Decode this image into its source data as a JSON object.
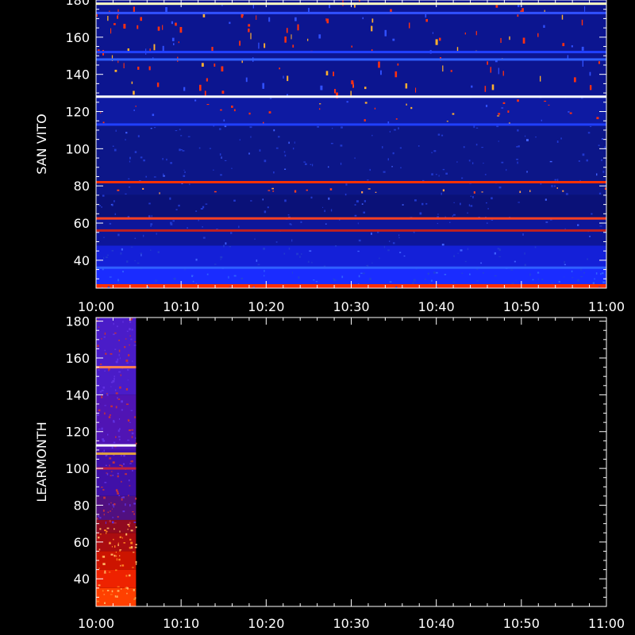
{
  "chart_data": [
    {
      "type": "heatmap",
      "ylabel": "SAN VITO",
      "xlabel": "",
      "x_ticks": [
        "10:00",
        "10:10",
        "10:20",
        "10:30",
        "10:40",
        "10:50",
        "11:00"
      ],
      "y_ticks": [
        40,
        60,
        80,
        100,
        120,
        140,
        160,
        180
      ],
      "xlim_minutes": [
        0,
        60
      ],
      "ylim": [
        25,
        180
      ],
      "data_coverage_minutes": [
        0,
        60
      ],
      "bands": [
        {
          "y0": 25,
          "y1": 27,
          "color": "#ff2a00"
        },
        {
          "y0": 27,
          "y1": 36,
          "color": "#1a2cff"
        },
        {
          "y0": 36,
          "y1": 48,
          "color": "#1420d8"
        },
        {
          "y0": 48,
          "y1": 62,
          "color": "#0d169a"
        },
        {
          "y0": 62,
          "y1": 75,
          "color": "#0a1178"
        },
        {
          "y0": 75,
          "y1": 113,
          "color": "#0c1688"
        },
        {
          "y0": 113,
          "y1": 128,
          "color": "#0e1aa2"
        },
        {
          "y0": 128,
          "y1": 178,
          "color": "#0c1590"
        },
        {
          "y0": 178,
          "y1": 180,
          "color": "#0c1590"
        }
      ],
      "lines": [
        {
          "y": 178,
          "color": "#ffffc0"
        },
        {
          "y": 173,
          "color": "#3050ff"
        },
        {
          "y": 152,
          "color": "#2040ff"
        },
        {
          "y": 148,
          "color": "#3060ff"
        },
        {
          "y": 128,
          "color": "#ffffff"
        },
        {
          "y": 113,
          "color": "#2040ff"
        },
        {
          "y": 82,
          "color": "#ff3000"
        },
        {
          "y": 62.5,
          "color": "#ff4020"
        },
        {
          "y": 56,
          "color": "#c02020"
        },
        {
          "y": 36,
          "color": "#3060ff"
        },
        {
          "y": 26.5,
          "color": "#ff3000"
        }
      ]
    },
    {
      "type": "heatmap",
      "ylabel": "LEARMONTH",
      "xlabel": "",
      "x_ticks": [
        "10:00",
        "10:10",
        "10:20",
        "10:30",
        "10:40",
        "10:50",
        "11:00"
      ],
      "y_ticks": [
        40,
        60,
        80,
        100,
        120,
        140,
        160,
        180
      ],
      "xlim_minutes": [
        0,
        60
      ],
      "ylim": [
        25,
        182
      ],
      "data_coverage_minutes": [
        0,
        4.7
      ],
      "bands": [
        {
          "y0": 25,
          "y1": 35,
          "color": "#ff4000"
        },
        {
          "y0": 35,
          "y1": 45,
          "color": "#ee2200"
        },
        {
          "y0": 45,
          "y1": 55,
          "color": "#cc1400"
        },
        {
          "y0": 55,
          "y1": 65,
          "color": "#aa0c10"
        },
        {
          "y0": 65,
          "y1": 72,
          "color": "#900a20"
        },
        {
          "y0": 72,
          "y1": 85,
          "color": "#501080"
        },
        {
          "y0": 85,
          "y1": 110,
          "color": "#4010a8"
        },
        {
          "y0": 110,
          "y1": 140,
          "color": "#5014b4"
        },
        {
          "y0": 140,
          "y1": 182,
          "color": "#4a1cc8"
        }
      ],
      "lines": [
        {
          "y": 155,
          "color": "#ff8050"
        },
        {
          "y": 112.5,
          "color": "#ffffff"
        },
        {
          "y": 108,
          "color": "#e0a040"
        },
        {
          "y": 100,
          "color": "#c02040"
        }
      ]
    }
  ]
}
